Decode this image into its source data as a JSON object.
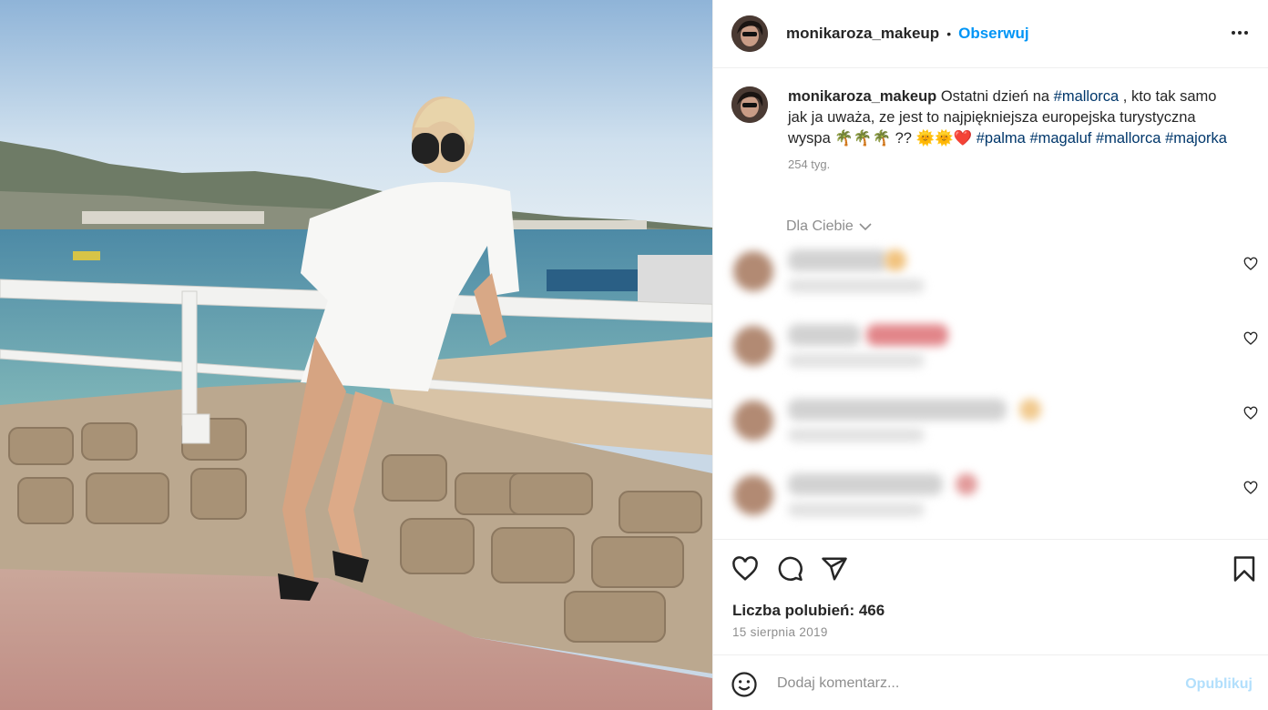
{
  "post": {
    "username": "monikaroza_makeup",
    "follow_label": "Obserwuj",
    "separator": "•"
  },
  "caption": {
    "username": "monikaroza_makeup",
    "text1": " Ostatni dzień na ",
    "tag1": "#mallorca",
    "text2": " , kto tak samo jak ja uważa, ze jest to najpiękniejsza europejska turystyczna wyspa 🌴🌴🌴 ?? 🌞🌞❤️ ",
    "tag2": "#palma",
    "tag3": "#magaluf",
    "tag4": "#mallorca",
    "tag5": "#majorka",
    "time": "254 tyg."
  },
  "comments": {
    "filter_label": "Dla Ciebie"
  },
  "actions": {
    "likes_text": "Liczba polubień: 466",
    "date": "15 sierpnia 2019"
  },
  "comment_box": {
    "placeholder": "Dodaj komentarz...",
    "post_label": "Opublikuj"
  },
  "colors": {
    "accent": "#0095f6",
    "hashtag": "#00376b",
    "muted": "#8e8e8e",
    "post_disabled": "#b2dffc"
  },
  "icons": [
    "more-icon",
    "chevron-down-icon",
    "heart-icon",
    "comment-icon",
    "share-icon",
    "bookmark-icon",
    "emoji-icon"
  ]
}
